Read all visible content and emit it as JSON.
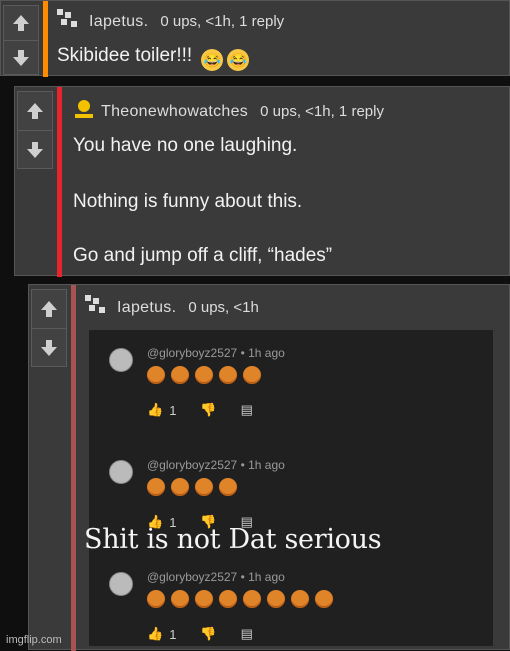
{
  "comments": [
    {
      "username": "Iapetus.",
      "stats": "0 ups, <1h, 1 reply",
      "text": "Skibidee toiler!!!",
      "emoji_icons": [
        "laughing-crying-emoji",
        "laughing-crying-emoji"
      ],
      "accent_color": "#ff8c00"
    },
    {
      "username": "Theonewhowatches",
      "stats": "0 ups, <1h, 1 reply",
      "lines": [
        "You have no one laughing.",
        "Nothing is funny about this.",
        "Go and jump off a cliff, “hades”"
      ],
      "accent_color": "#e8252c"
    },
    {
      "username": "Iapetus.",
      "stats": "0 ups, <1h",
      "accent_color": "#a85353",
      "embedded_image": {
        "entries": [
          {
            "handle": "@gloryboyz2527 • 1h ago",
            "emoji_count": 5,
            "likes": "1"
          },
          {
            "handle": "@gloryboyz2527 • 1h ago",
            "emoji_count": 4,
            "likes": "1"
          },
          {
            "handle": "@gloryboyz2527 • 1h ago",
            "emoji_count": 8,
            "likes": "1"
          }
        ],
        "overlay_caption": "Shit is not Dat serious"
      }
    }
  ],
  "watermark": "imgflip.com",
  "colors": {
    "upvote": "#cfcfcf",
    "angry_emoji": "#e0842a"
  }
}
